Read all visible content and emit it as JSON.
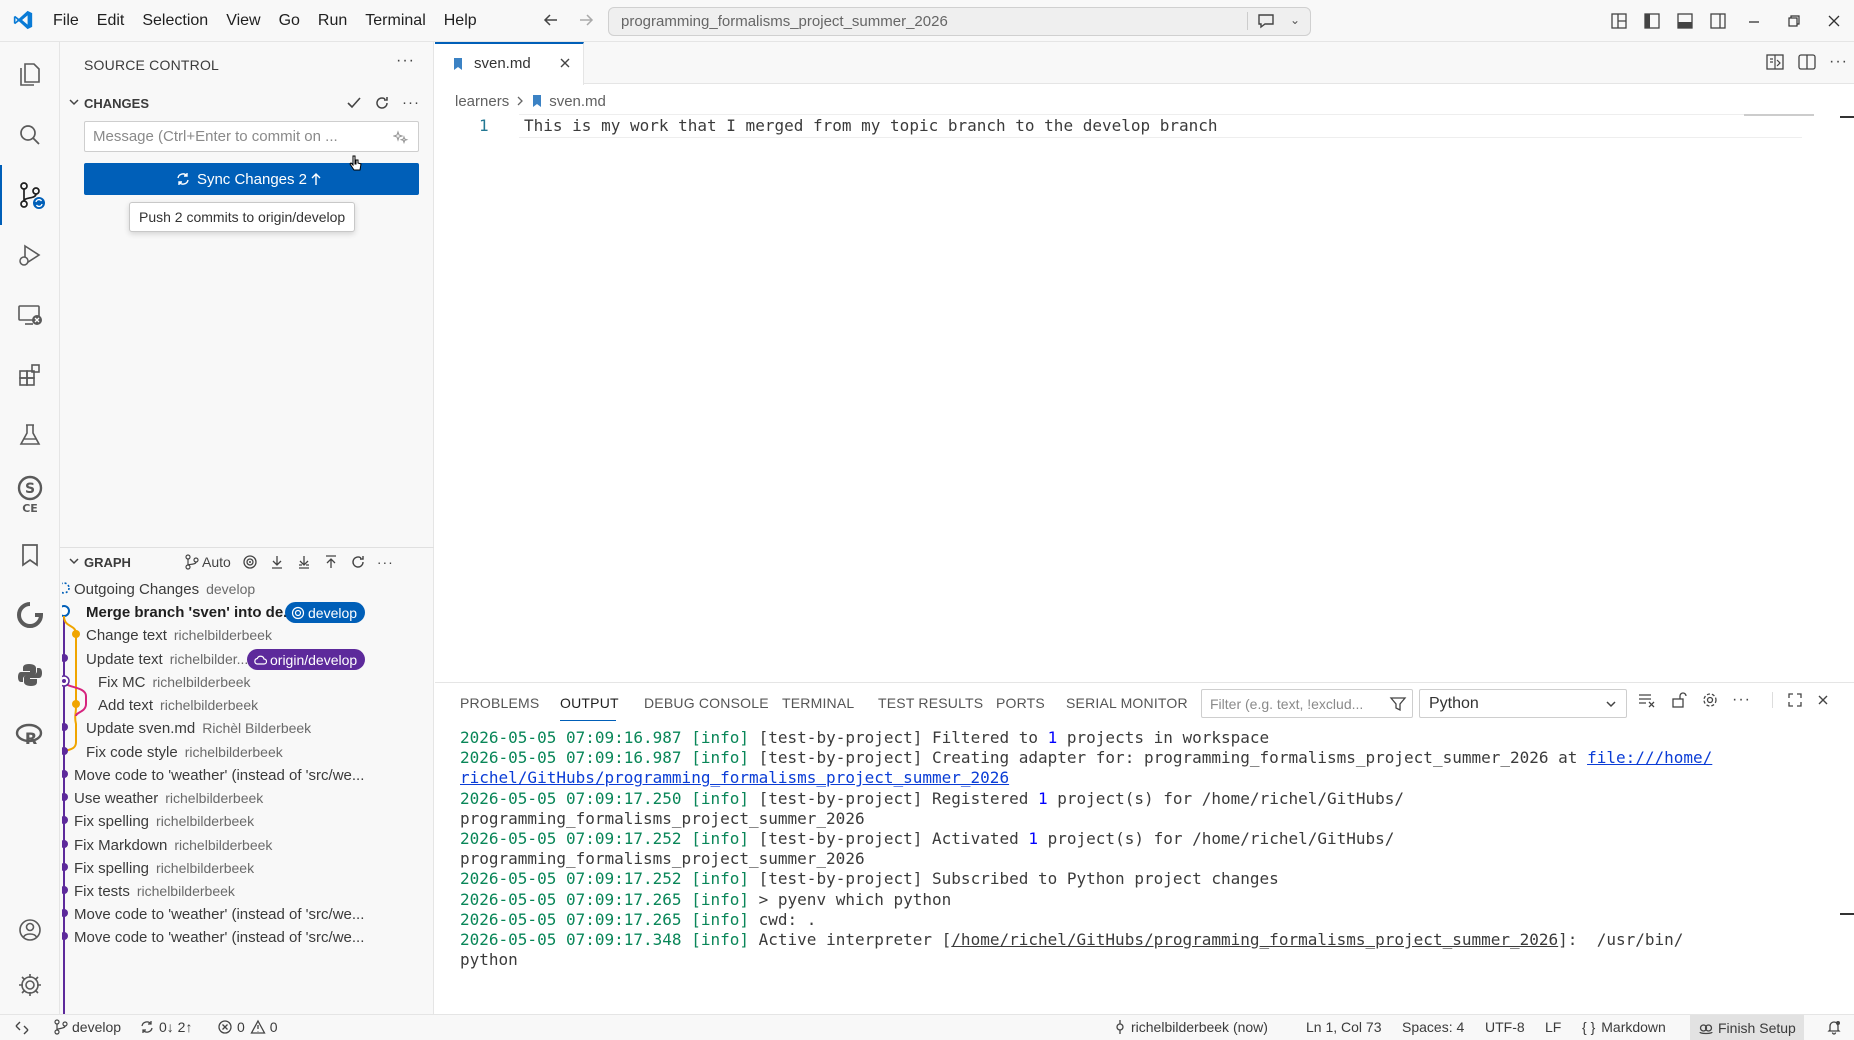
{
  "titlebar": {
    "menu": [
      "File",
      "Edit",
      "Selection",
      "View",
      "Go",
      "Run",
      "Terminal",
      "Help"
    ],
    "search_text": "programming_formalisms_project_summer_2026"
  },
  "sidebar": {
    "title": "SOURCE CONTROL",
    "changes_label": "CHANGES",
    "commit_placeholder": "Message (Ctrl+Enter to commit on ...",
    "sync_label": "Sync Changes 2",
    "tooltip": "Push 2 commits to origin/develop",
    "graph_label": "GRAPH",
    "graph_auto": "Auto"
  },
  "graph": [
    {
      "msg": "Outgoing Changes",
      "author": "develop"
    },
    {
      "msg": "Merge branch 'sven' into de...",
      "author": "",
      "badge": "develop"
    },
    {
      "msg": "Change text",
      "author": "richelbilderbeek"
    },
    {
      "msg": "Update text",
      "author": "richelbilder...",
      "badge": "origin/develop"
    },
    {
      "msg": "Fix MC",
      "author": "richelbilderbeek"
    },
    {
      "msg": "Add text",
      "author": "richelbilderbeek"
    },
    {
      "msg": "Update sven.md",
      "author": "Richèl Bilderbeek"
    },
    {
      "msg": "Fix code style",
      "author": "richelbilderbeek"
    },
    {
      "msg": "Move code to 'weather' (instead of 'src/we...",
      "author": ""
    },
    {
      "msg": "Use weather",
      "author": "richelbilderbeek"
    },
    {
      "msg": "Fix spelling",
      "author": "richelbilderbeek"
    },
    {
      "msg": "Fix Markdown",
      "author": "richelbilderbeek"
    },
    {
      "msg": "Fix spelling",
      "author": "richelbilderbeek"
    },
    {
      "msg": "Fix tests",
      "author": "richelbilderbeek"
    },
    {
      "msg": "Move code to 'weather' (instead of 'src/we...",
      "author": ""
    },
    {
      "msg": "Move code to 'weather' (instead of 'src/we...",
      "author": ""
    }
  ],
  "editor": {
    "tab": "sven.md",
    "breadcrumb": [
      "learners",
      "sven.md"
    ],
    "line_number": "1",
    "line_text": "This is my work that I merged from my topic branch to the develop branch"
  },
  "panel": {
    "tabs": [
      "PROBLEMS",
      "OUTPUT",
      "DEBUG CONSOLE",
      "TERMINAL",
      "TEST RESULTS",
      "PORTS",
      "SERIAL MONITOR"
    ],
    "filter_placeholder": "Filter (e.g. text, !exclud...",
    "channel": "Python",
    "lines": {
      "l1_ts": "2026-05-05 07:09:16.987",
      "l1_a": "[test-by-project] Filtered to ",
      "l1_n": "1",
      "l1_b": " projects in workspace",
      "l2_ts": "2026-05-05 07:09:16.987",
      "l2_a": "[test-by-project] Creating adapter for: programming_formalisms_project_summer_2026 at ",
      "l2_link": "file:///home/",
      "l2_link2": "richel/GitHubs/programming_formalisms_project_summer_2026",
      "l3_ts": "2026-05-05 07:09:17.250",
      "l3_a": "[test-by-project] Registered ",
      "l3_n": "1",
      "l3_b": " project(s) for /home/richel/GitHubs/",
      "l3_c": "programming_formalisms_project_summer_2026",
      "l4_ts": "2026-05-05 07:09:17.252",
      "l4_a": "[test-by-project] Activated ",
      "l4_n": "1",
      "l4_b": " project(s) for /home/richel/GitHubs/",
      "l4_c": "programming_formalisms_project_summer_2026",
      "l5_ts": "2026-05-05 07:09:17.252",
      "l5_a": "[test-by-project] Subscribed to Python project changes",
      "l6_ts": "2026-05-05 07:09:17.265",
      "l6_a": "> pyenv which python",
      "l7_ts": "2026-05-05 07:09:17.265",
      "l7_a": "cwd: .",
      "l8_ts": "2026-05-05 07:09:17.348",
      "l8_a": "Active interpreter [",
      "l8_u": "/home/richel/GitHubs/programming_formalisms_project_summer_2026",
      "l8_b": "]:  /usr/bin/",
      "l8_c": "python",
      "info": "[info]"
    }
  },
  "statusbar": {
    "branch": "develop",
    "sync": "0↓ 2↑",
    "errors": "0",
    "warnings": "0",
    "blame": "richelbilderbeek (now)",
    "position": "Ln 1, Col 73",
    "spaces": "Spaces: 4",
    "encoding": "UTF-8",
    "eol": "LF",
    "language": "Markdown",
    "finish_setup": "Finish Setup"
  },
  "colors": {
    "accent": "#005fb8",
    "graph_blue": "#005fb8",
    "graph_yellow": "#f0a500",
    "graph_purple": "#5d2a9b",
    "graph_pink": "#d6247e"
  }
}
